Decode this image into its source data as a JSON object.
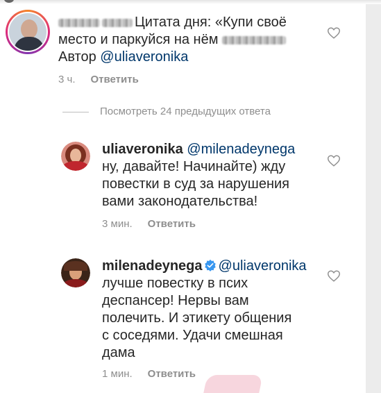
{
  "comment_main": {
    "prefix": "Цитата дня: «Купи своё",
    "line2": "место и паркуйся на нём",
    "author_label": "Автор",
    "mention": "@uliaveronika",
    "time": "3 ч.",
    "reply_label": "Ответить"
  },
  "view_replies": "Посмотреть 24 предыдущих ответа",
  "reply1": {
    "username": "uliaveronika",
    "mention": "@milenadeynega",
    "lines": [
      "ну, давайте! Начинайте) жду",
      "повестки в суд за нарушения",
      "вами законодательства!"
    ],
    "time": "3 мин.",
    "reply_label": "Ответить"
  },
  "reply2": {
    "username": "milenadeynega",
    "mention": "@uliaveronika",
    "lines": [
      "лучше повестку в псих",
      "деспансер! Нервы вам",
      "полечить. И этикету общения",
      "с соседями.  Удачи смешная",
      "дама"
    ],
    "time": "1 мин.",
    "reply_label": "Ответить"
  },
  "colors": {
    "mention": "#00376b",
    "meta": "#8e8e8e",
    "verified": "#3897f0"
  },
  "icons": [
    "heart-icon",
    "verified-badge-icon"
  ]
}
